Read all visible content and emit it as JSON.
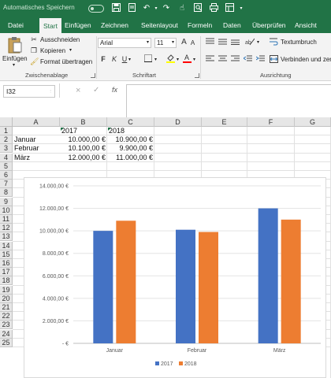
{
  "titlebar": {
    "autosave_label": "Automatisches Speichern",
    "autosave_state": "Aus",
    "quick_access": [
      "save-icon",
      "undo-icon",
      "redo-icon",
      "touch-mode-icon",
      "print-preview-icon",
      "print-icon",
      "form-icon"
    ]
  },
  "tabs": [
    {
      "label": "Datei"
    },
    {
      "label": "Start"
    },
    {
      "label": "Einfügen"
    },
    {
      "label": "Zeichnen"
    },
    {
      "label": "Seitenlayout"
    },
    {
      "label": "Formeln"
    },
    {
      "label": "Daten"
    },
    {
      "label": "Überprüfen"
    },
    {
      "label": "Ansicht"
    }
  ],
  "ribbon": {
    "clipboard": {
      "paste_label": "Einfügen",
      "cut_label": "Ausschneiden",
      "copy_label": "Kopieren",
      "format_painter_label": "Format übertragen",
      "group_label": "Zwischenablage"
    },
    "font": {
      "font_name": "Arial",
      "font_size": "11",
      "bold": "F",
      "italic": "K",
      "underline": "U",
      "group_label": "Schriftart"
    },
    "alignment": {
      "wrap_text_label": "Textumbruch",
      "merge_label": "Verbinden und zen",
      "group_label": "Ausrichtung"
    }
  },
  "formula_bar": {
    "name_box": "I32",
    "cancel": "×",
    "enter": "✓",
    "fx": "fx",
    "formula": ""
  },
  "sheet": {
    "columns": [
      "A",
      "B",
      "C",
      "D",
      "E",
      "F",
      "G"
    ],
    "rows": [
      "1",
      "2",
      "3",
      "4",
      "5",
      "6",
      "7",
      "8",
      "9",
      "10",
      "11",
      "12",
      "13",
      "14",
      "15",
      "16",
      "17",
      "18",
      "19",
      "20",
      "21",
      "22",
      "23",
      "24",
      "25"
    ],
    "cells": {
      "B1": "2017",
      "C1": "2018",
      "A2": "Januar",
      "B2": "10.000,00 €",
      "C2": "10.900,00 €",
      "A3": "Februar",
      "B3": "10.100,00 €",
      "C3": "9.900,00 €",
      "A4": "März",
      "B4": "12.000,00 €",
      "C4": "11.000,00 €"
    }
  },
  "chart_data": {
    "type": "bar",
    "categories": [
      "Januar",
      "Februar",
      "März"
    ],
    "series": [
      {
        "name": "2017",
        "values": [
          10000,
          10100,
          12000
        ],
        "color": "#4472c4"
      },
      {
        "name": "2018",
        "values": [
          10900,
          9900,
          11000
        ],
        "color": "#ed7d31"
      }
    ],
    "ylim": [
      0,
      14000
    ],
    "yticks": [
      0,
      2000,
      4000,
      6000,
      8000,
      10000,
      12000,
      14000
    ],
    "ytick_labels": [
      "-   €",
      "2.000,00 €",
      "4.000,00 €",
      "6.000,00 €",
      "8.000,00 €",
      "10.000,00 €",
      "12.000,00 €",
      "14.000,00 €"
    ],
    "grid": true,
    "legend": "bottom"
  },
  "colors": {
    "accent": "#217346",
    "series_2017": "#4472c4",
    "series_2018": "#ed7d31"
  }
}
